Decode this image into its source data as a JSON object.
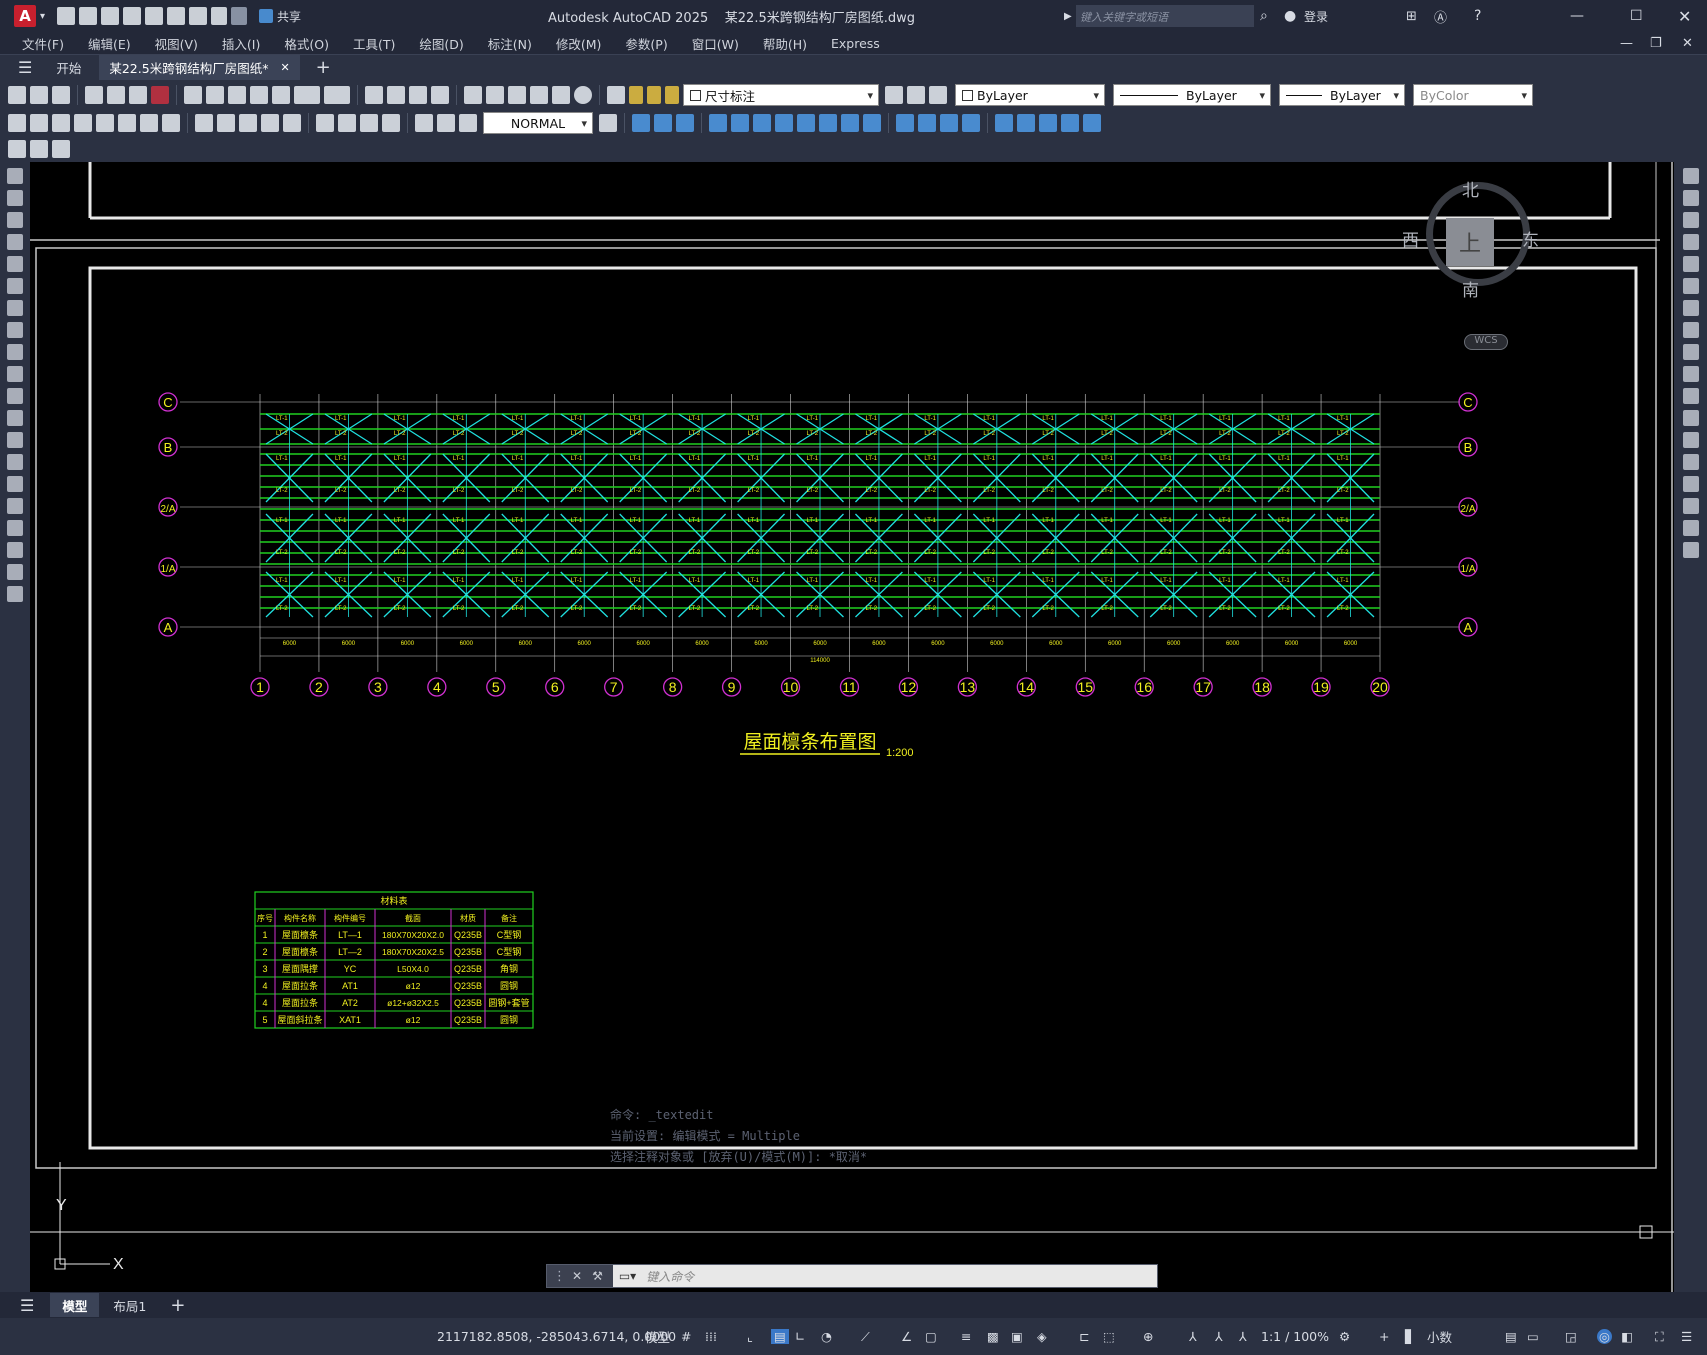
{
  "title": {
    "app_icon": "A",
    "share_label": "共享",
    "app_name": "Autodesk AutoCAD 2025",
    "file_name": "某22.5米跨钢结构厂房图纸.dwg",
    "search_placeholder": "键入关键字或短语",
    "login_label": "登录"
  },
  "menu": [
    "文件(F)",
    "编辑(E)",
    "视图(V)",
    "插入(I)",
    "格式(O)",
    "工具(T)",
    "绘图(D)",
    "标注(N)",
    "修改(M)",
    "参数(P)",
    "窗口(W)",
    "帮助(H)",
    "Express"
  ],
  "tabs": {
    "start": "开始",
    "doc": "某22.5米跨钢结构厂房图纸*"
  },
  "toolbar": {
    "layer": "尺寸标注",
    "color": "ByLayer",
    "linetype": "ByLayer",
    "lineweight": "ByLayer",
    "plotstyle": "ByColor",
    "textstyle": "NORMAL"
  },
  "viewcube": {
    "n": "北",
    "s": "南",
    "e": "东",
    "w": "西",
    "top": "上",
    "wcs": "WCS"
  },
  "drawing": {
    "title": "屋面檩条布置图",
    "scale": "1:200",
    "rows": [
      "C",
      "B",
      "2/A",
      "1/A",
      "A"
    ],
    "cols": [
      "1",
      "2",
      "3",
      "4",
      "5",
      "6",
      "7",
      "8",
      "9",
      "10",
      "11",
      "12",
      "13",
      "14",
      "15",
      "16",
      "17",
      "18",
      "19",
      "20"
    ],
    "bay": "6000",
    "total": "114000",
    "purlin_labels": [
      "LT-1",
      "LT-2"
    ]
  },
  "table": {
    "title": "材料表",
    "headers": [
      "序号",
      "构件名称",
      "构件编号",
      "截面",
      "材质",
      "备注"
    ],
    "rows": [
      [
        "1",
        "屋面檩条",
        "LT—1",
        "180X70X20X2.0",
        "Q235B",
        "C型钢"
      ],
      [
        "2",
        "屋面檩条",
        "LT—2",
        "180X70X20X2.5",
        "Q235B",
        "C型钢"
      ],
      [
        "3",
        "屋面隅撑",
        "YC",
        "L50X4.0",
        "Q235B",
        "角钢"
      ],
      [
        "4",
        "屋面拉条",
        "AT1",
        "ø12",
        "Q235B",
        "圆钢"
      ],
      [
        "4",
        "屋面拉条",
        "AT2",
        "ø12+ø32X2.5",
        "Q235B",
        "圆钢+套管"
      ],
      [
        "5",
        "屋面斜拉条",
        "XAT1",
        "ø12",
        "Q235B",
        "圆钢"
      ]
    ]
  },
  "command": {
    "history": [
      "命令: _textedit",
      "当前设置: 编辑模式 = Multiple",
      "选择注释对象或 [放弃(U)/模式(M)]: *取消*"
    ],
    "placeholder": "键入命令"
  },
  "layouts": {
    "model": "模型",
    "layout1": "布局1"
  },
  "status": {
    "coords": "2117182.8508, -285043.6714, 0.0000",
    "space": "模型",
    "scale": "1:1 / 100%",
    "units": "小数"
  },
  "axis": {
    "x": "X",
    "y": "Y"
  }
}
